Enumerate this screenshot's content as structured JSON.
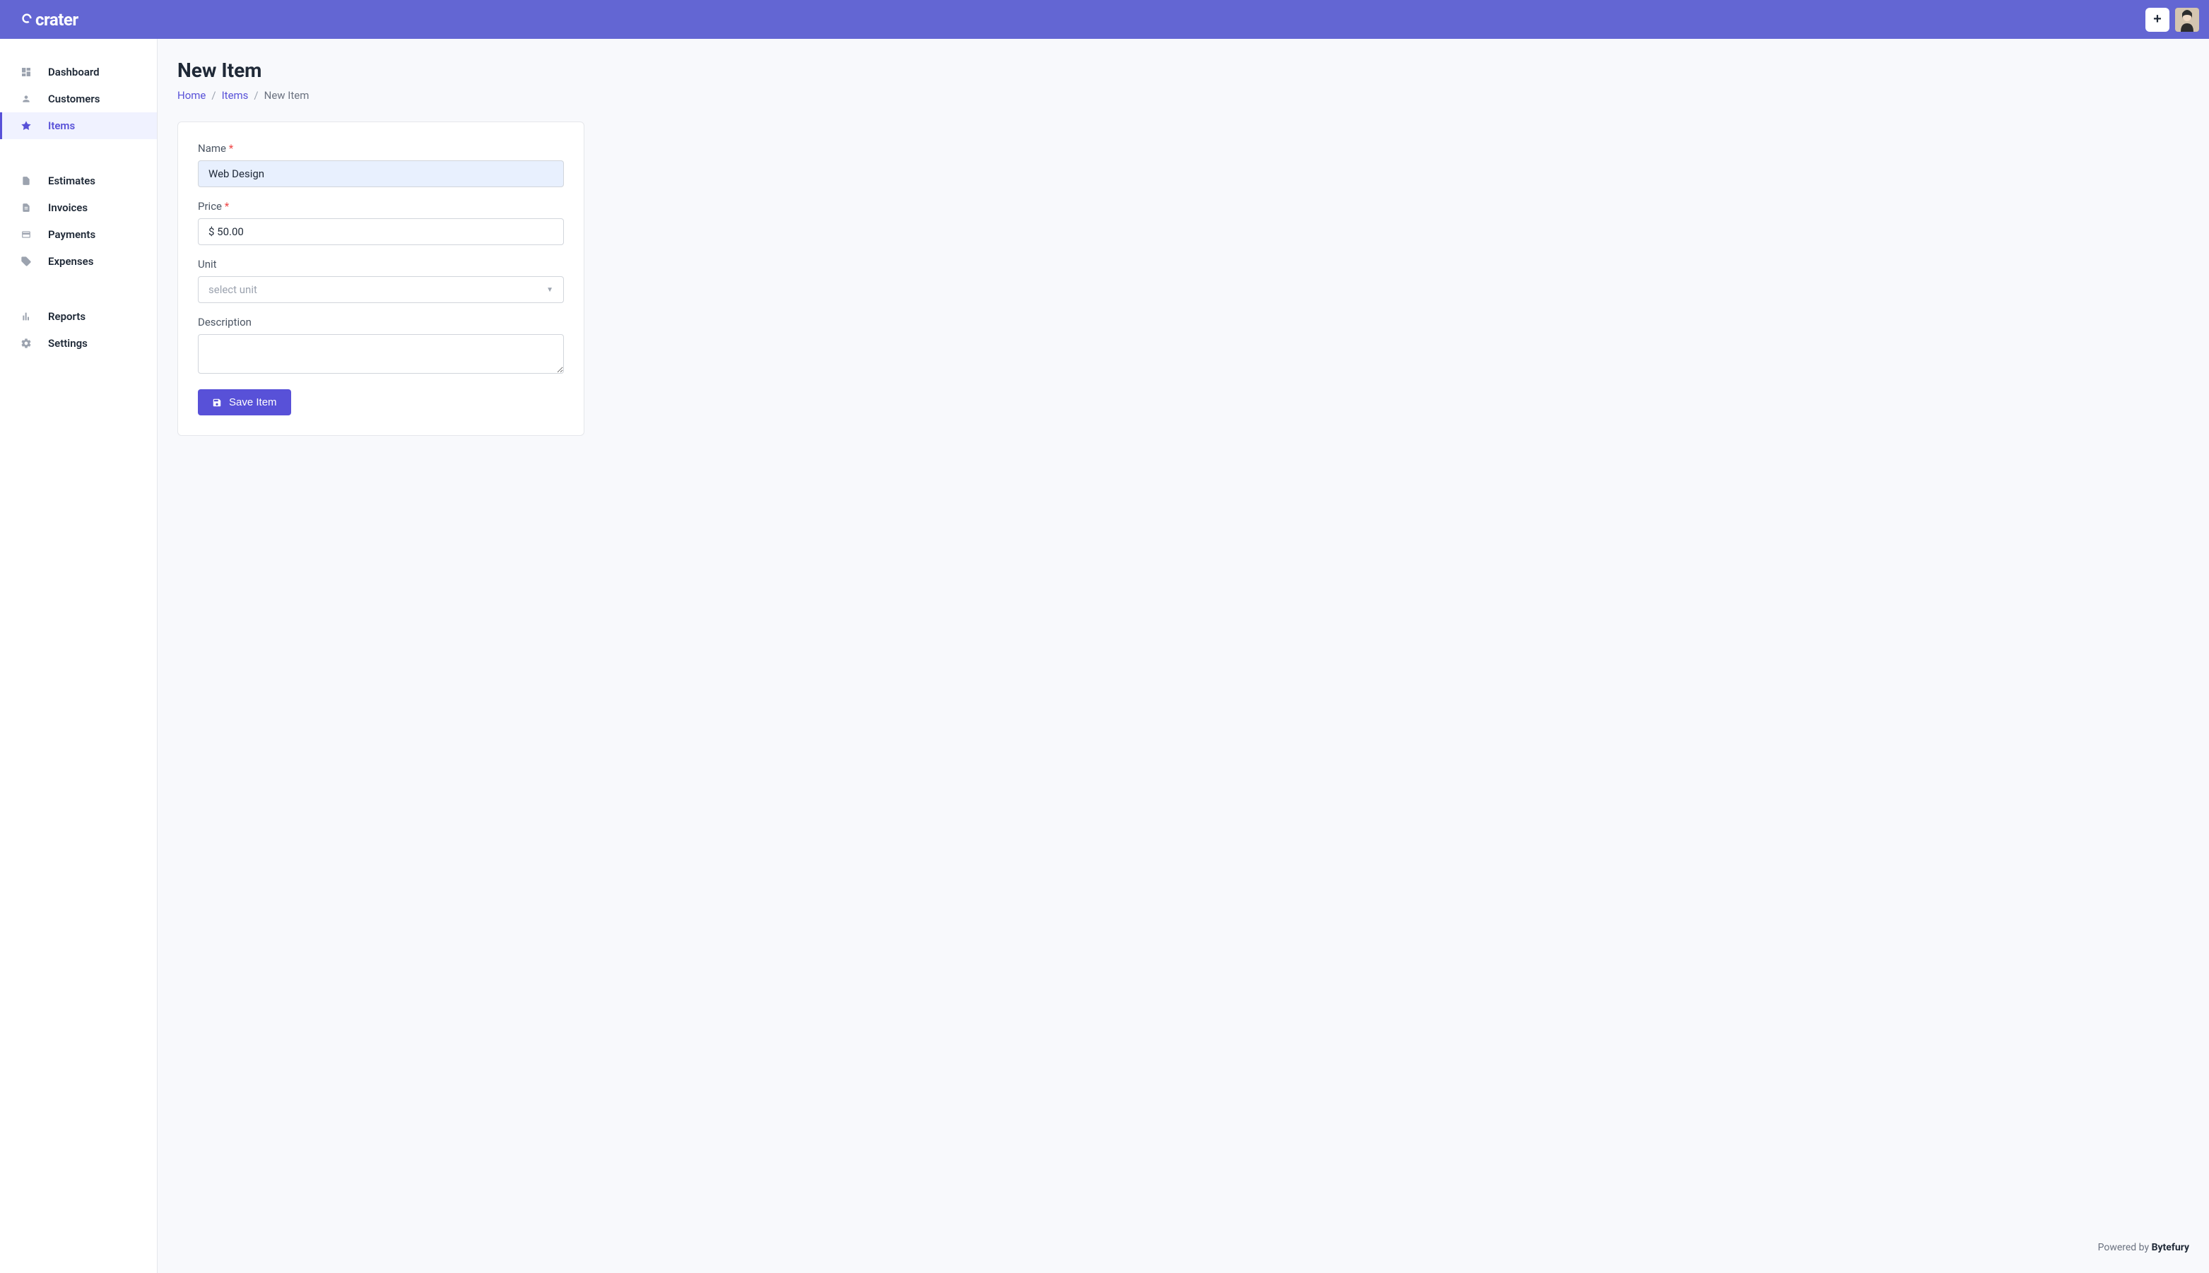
{
  "header": {
    "logo_text": "crater",
    "add_button": "+"
  },
  "sidebar": {
    "groups": [
      {
        "items": [
          {
            "label": "Dashboard",
            "icon": "dashboard-icon",
            "active": false
          },
          {
            "label": "Customers",
            "icon": "user-icon",
            "active": false
          },
          {
            "label": "Items",
            "icon": "star-icon",
            "active": true
          }
        ]
      },
      {
        "items": [
          {
            "label": "Estimates",
            "icon": "document-icon",
            "active": false
          },
          {
            "label": "Invoices",
            "icon": "file-invoice-icon",
            "active": false
          },
          {
            "label": "Payments",
            "icon": "credit-card-icon",
            "active": false
          },
          {
            "label": "Expenses",
            "icon": "tag-icon",
            "active": false
          }
        ]
      },
      {
        "items": [
          {
            "label": "Reports",
            "icon": "chart-icon",
            "active": false
          },
          {
            "label": "Settings",
            "icon": "gear-icon",
            "active": false
          }
        ]
      }
    ]
  },
  "page": {
    "title": "New Item",
    "breadcrumb": {
      "home": "Home",
      "items": "Items",
      "current": "New Item",
      "separator": "/"
    }
  },
  "form": {
    "name_label": "Name",
    "name_value": "Web Design",
    "price_label": "Price",
    "price_value": "$ 50.00",
    "unit_label": "Unit",
    "unit_placeholder": "select unit",
    "description_label": "Description",
    "description_value": "",
    "save_button": "Save Item"
  },
  "footer": {
    "powered_by": "Powered by ",
    "company": "Bytefury"
  }
}
